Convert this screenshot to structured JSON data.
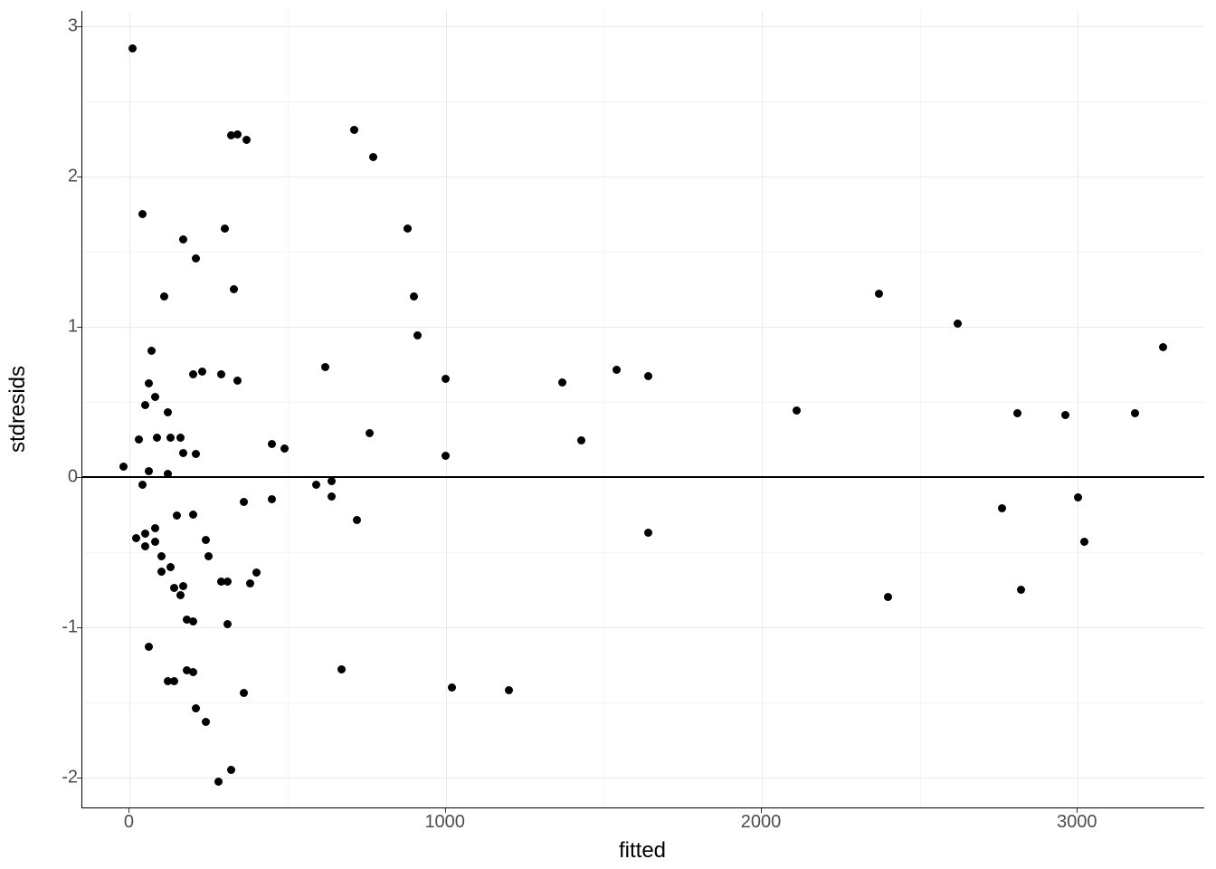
{
  "chart_data": {
    "type": "scatter",
    "xlabel": "fitted",
    "ylabel": "stdresids",
    "title": "",
    "xlim": [
      -150,
      3400
    ],
    "ylim": [
      -2.2,
      3.1
    ],
    "x_ticks": [
      0,
      1000,
      2000,
      3000
    ],
    "y_ticks": [
      -2,
      -1,
      0,
      1,
      2,
      3
    ],
    "hline": 0,
    "points": [
      {
        "x": 10,
        "y": 2.85
      },
      {
        "x": 40,
        "y": 1.75
      },
      {
        "x": 110,
        "y": 1.2
      },
      {
        "x": 170,
        "y": 1.58
      },
      {
        "x": 70,
        "y": 0.84
      },
      {
        "x": 60,
        "y": 0.62
      },
      {
        "x": 50,
        "y": 0.48
      },
      {
        "x": 80,
        "y": 0.53
      },
      {
        "x": 120,
        "y": 0.43
      },
      {
        "x": 320,
        "y": 2.27
      },
      {
        "x": 340,
        "y": 2.28
      },
      {
        "x": 370,
        "y": 2.24
      },
      {
        "x": 300,
        "y": 1.65
      },
      {
        "x": 210,
        "y": 1.45
      },
      {
        "x": 330,
        "y": 1.25
      },
      {
        "x": 230,
        "y": 0.7
      },
      {
        "x": 200,
        "y": 0.68
      },
      {
        "x": 290,
        "y": 0.68
      },
      {
        "x": 340,
        "y": 0.64
      },
      {
        "x": 450,
        "y": 0.22
      },
      {
        "x": 490,
        "y": 0.19
      },
      {
        "x": 710,
        "y": 2.31
      },
      {
        "x": 770,
        "y": 2.13
      },
      {
        "x": 620,
        "y": 0.73
      },
      {
        "x": 760,
        "y": 0.29
      },
      {
        "x": 880,
        "y": 1.65
      },
      {
        "x": 900,
        "y": 1.2
      },
      {
        "x": 910,
        "y": 0.94
      },
      {
        "x": 1000,
        "y": 0.65
      },
      {
        "x": 1000,
        "y": 0.14
      },
      {
        "x": 1370,
        "y": 0.63
      },
      {
        "x": 1430,
        "y": 0.24
      },
      {
        "x": 1540,
        "y": 0.71
      },
      {
        "x": 1640,
        "y": 0.67
      },
      {
        "x": 2110,
        "y": 0.44
      },
      {
        "x": 2370,
        "y": 1.22
      },
      {
        "x": 2620,
        "y": 1.02
      },
      {
        "x": 2810,
        "y": 0.42
      },
      {
        "x": 2960,
        "y": 0.41
      },
      {
        "x": 3180,
        "y": 0.42
      },
      {
        "x": 3270,
        "y": 0.86
      },
      {
        "x": -20,
        "y": 0.07
      },
      {
        "x": 30,
        "y": 0.25
      },
      {
        "x": 60,
        "y": 0.04
      },
      {
        "x": 85,
        "y": 0.26
      },
      {
        "x": 120,
        "y": 0.02
      },
      {
        "x": 130,
        "y": 0.26
      },
      {
        "x": 160,
        "y": 0.26
      },
      {
        "x": 170,
        "y": 0.16
      },
      {
        "x": 210,
        "y": 0.15
      },
      {
        "x": 40,
        "y": -0.05
      },
      {
        "x": 150,
        "y": -0.26
      },
      {
        "x": 200,
        "y": -0.25
      },
      {
        "x": 360,
        "y": -0.17
      },
      {
        "x": 450,
        "y": -0.15
      },
      {
        "x": 590,
        "y": -0.05
      },
      {
        "x": 640,
        "y": -0.03
      },
      {
        "x": 20,
        "y": -0.41
      },
      {
        "x": 50,
        "y": -0.38
      },
      {
        "x": 50,
        "y": -0.46
      },
      {
        "x": 80,
        "y": -0.34
      },
      {
        "x": 80,
        "y": -0.43
      },
      {
        "x": 100,
        "y": -0.53
      },
      {
        "x": 240,
        "y": -0.42
      },
      {
        "x": 250,
        "y": -0.53
      },
      {
        "x": 100,
        "y": -0.63
      },
      {
        "x": 130,
        "y": -0.6
      },
      {
        "x": 140,
        "y": -0.74
      },
      {
        "x": 170,
        "y": -0.73
      },
      {
        "x": 290,
        "y": -0.7
      },
      {
        "x": 310,
        "y": -0.7
      },
      {
        "x": 380,
        "y": -0.71
      },
      {
        "x": 400,
        "y": -0.64
      },
      {
        "x": 160,
        "y": -0.79
      },
      {
        "x": 180,
        "y": -0.95
      },
      {
        "x": 200,
        "y": -0.96
      },
      {
        "x": 310,
        "y": -0.98
      },
      {
        "x": 640,
        "y": -0.13
      },
      {
        "x": 720,
        "y": -0.29
      },
      {
        "x": 1640,
        "y": -0.37
      },
      {
        "x": 2760,
        "y": -0.21
      },
      {
        "x": 3000,
        "y": -0.14
      },
      {
        "x": 3020,
        "y": -0.43
      },
      {
        "x": 2820,
        "y": -0.75
      },
      {
        "x": 2400,
        "y": -0.8
      },
      {
        "x": 60,
        "y": -1.13
      },
      {
        "x": 120,
        "y": -1.36
      },
      {
        "x": 140,
        "y": -1.36
      },
      {
        "x": 180,
        "y": -1.29
      },
      {
        "x": 200,
        "y": -1.3
      },
      {
        "x": 210,
        "y": -1.54
      },
      {
        "x": 240,
        "y": -1.63
      },
      {
        "x": 360,
        "y": -1.44
      },
      {
        "x": 670,
        "y": -1.28
      },
      {
        "x": 1020,
        "y": -1.4
      },
      {
        "x": 1200,
        "y": -1.42
      },
      {
        "x": 320,
        "y": -1.95
      },
      {
        "x": 280,
        "y": -2.03
      }
    ]
  }
}
